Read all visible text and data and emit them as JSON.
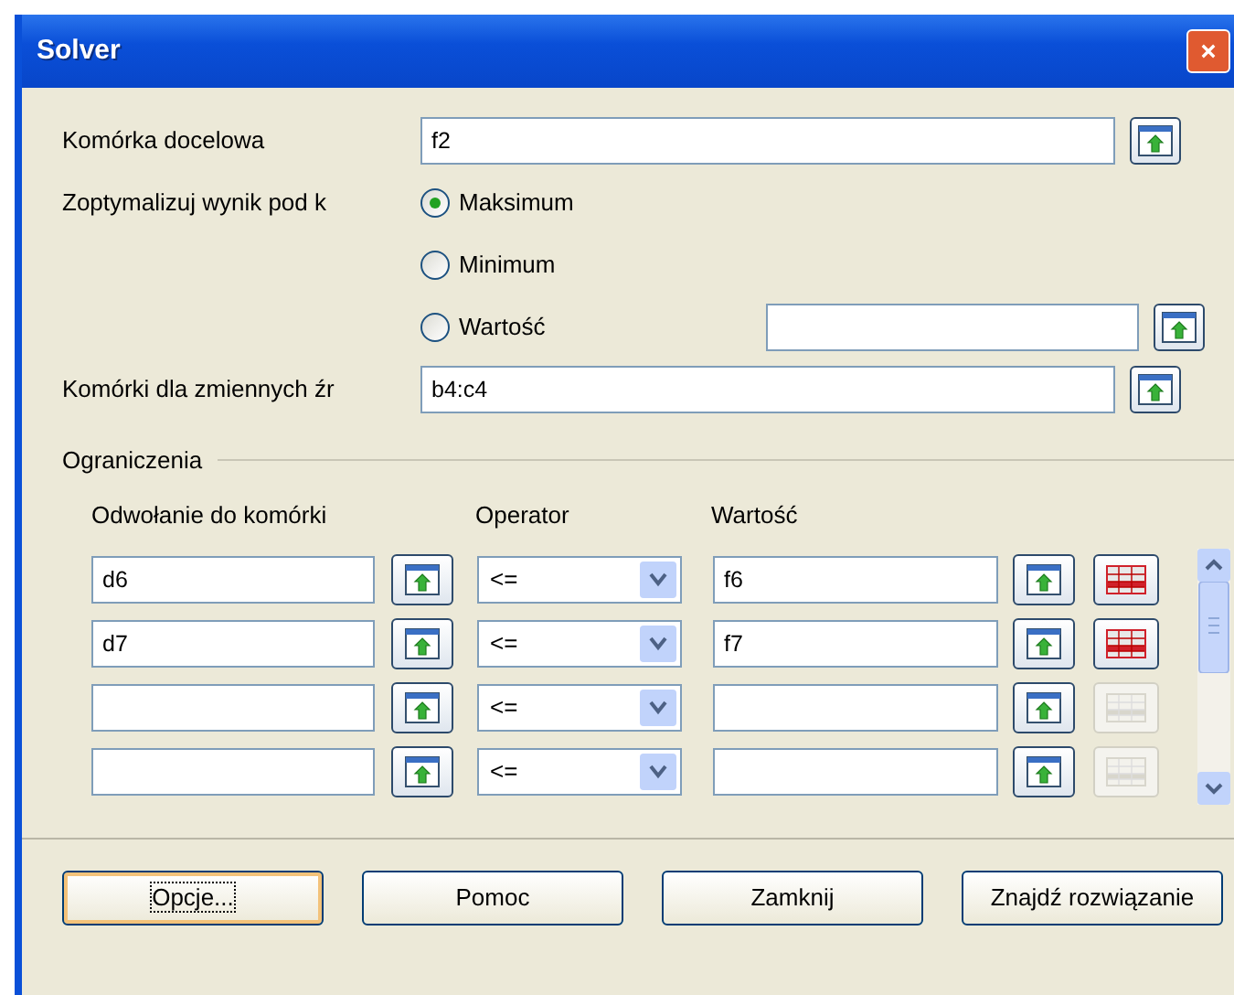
{
  "window": {
    "title": "Solver"
  },
  "target_cell": {
    "label": "Komórka docelowa",
    "value": "f2"
  },
  "optimize": {
    "label": "Zoptymalizuj wynik pod k",
    "options": [
      {
        "label": "Maksimum",
        "selected": true,
        "kind": "plain"
      },
      {
        "label": "Minimum",
        "selected": false,
        "kind": "plain"
      },
      {
        "label": "Wartość",
        "selected": false,
        "kind": "field"
      }
    ]
  },
  "variable_cells": {
    "label": "Komórki dla zmiennych źr",
    "value": "b4:c4"
  },
  "constraints": {
    "title": "Ograniczenia",
    "columns": [
      "Odwołanie do komórki",
      "Operator",
      "Wartość"
    ],
    "rows": [
      {
        "cell": "d6",
        "operator": "<=",
        "value": "f6",
        "removable": true
      },
      {
        "cell": "d7",
        "operator": "<=",
        "value": "f7",
        "removable": true
      },
      {
        "cell": "",
        "operator": "<=",
        "value": "",
        "removable": false
      },
      {
        "cell": "",
        "operator": "<=",
        "value": "",
        "removable": false
      }
    ]
  },
  "buttons": [
    {
      "label": "Opcje...",
      "focused": true
    },
    {
      "label": "Pomoc",
      "focused": false
    },
    {
      "label": "Zamknij",
      "focused": false
    },
    {
      "label": "Znajdź rozwiązanie",
      "focused": false
    }
  ]
}
